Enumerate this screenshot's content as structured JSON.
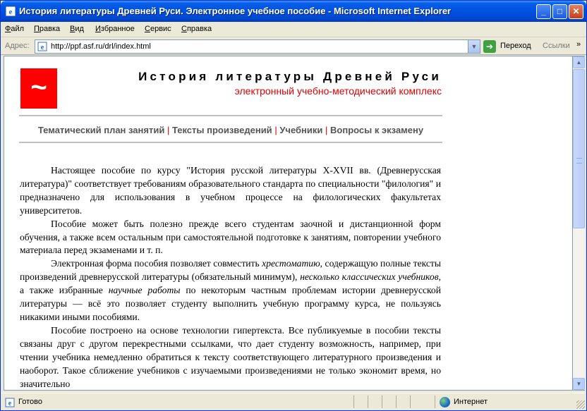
{
  "window": {
    "title": "История литературы Древней Руси. Электронное учебное пособие - Microsoft Internet Explorer",
    "buttons": {
      "minimize": "_",
      "maximize": "□",
      "close": "✕"
    }
  },
  "menu": {
    "items": [
      {
        "label": "Файл"
      },
      {
        "label": "Правка"
      },
      {
        "label": "Вид"
      },
      {
        "label": "Избранное"
      },
      {
        "label": "Сервис"
      },
      {
        "label": "Справка"
      }
    ]
  },
  "address": {
    "label": "Адрес:",
    "url": "http://ppf.asf.ru/drl/index.html",
    "go_label": "Переход",
    "links_label": "Ссылки",
    "links_arrow": "»"
  },
  "page": {
    "logo_glyph": "~",
    "title": "История литературы Древней Руси",
    "subtitle": "электронный учебно-методический комплекс",
    "nav": [
      "Тематический план занятий",
      "Тексты произведений",
      "Учебники",
      "Вопросы к экзамену"
    ],
    "nav_separator": "|",
    "paragraphs": {
      "p1": "Настоящее пособие по курсу \"История русской литературы X-XVII вв. (Древнерусская литература)\" соответствует требованиям образовательного стандарта по специальности \"филология\" и предназначено для использования в учебном процессе на филологических факультетах университетов.",
      "p2": "Пособие может быть полезно прежде всего студентам заочной и дистанционной форм обучения, а также всем остальным при самостоятельной подготовке к занятиям, повторении учебного материала перед экзаменами и т. п.",
      "p3_a": "Электронная форма пособия позволяет совместить ",
      "p3_em1": "хрестоматию",
      "p3_b": ", содержащую полные тексты произведений древнерусской литературы (обязательный минимум), ",
      "p3_em2": "несколько классических учебников",
      "p3_c": ", а также избранные ",
      "p3_em3": "научные работы",
      "p3_d": " по некоторым частным проблемам истории древнерусской литературы — всё это позволяет студенту выполнить учебную программу курса, не пользуясь никакими иными пособиями.",
      "p4": "Пособие построено на основе технологии гипертекста. Все публикуемые в пособии тексты связаны друг с другом перекрестными ссылками, что дает студенту возможность, например, при чтении учебника немедленно обратиться к тексту соответствующего литературного произведения и наоборот. Такое сближение учебников с изучаемыми произведениями не только экономит время, но значительно"
    }
  },
  "status": {
    "text": "Готово",
    "zone": "Интернет"
  },
  "colors": {
    "logo_red": "#ff0000",
    "subtitle_red": "#e00000",
    "nav_gray": "#555555",
    "titlebar_blue": "#0054e3"
  }
}
